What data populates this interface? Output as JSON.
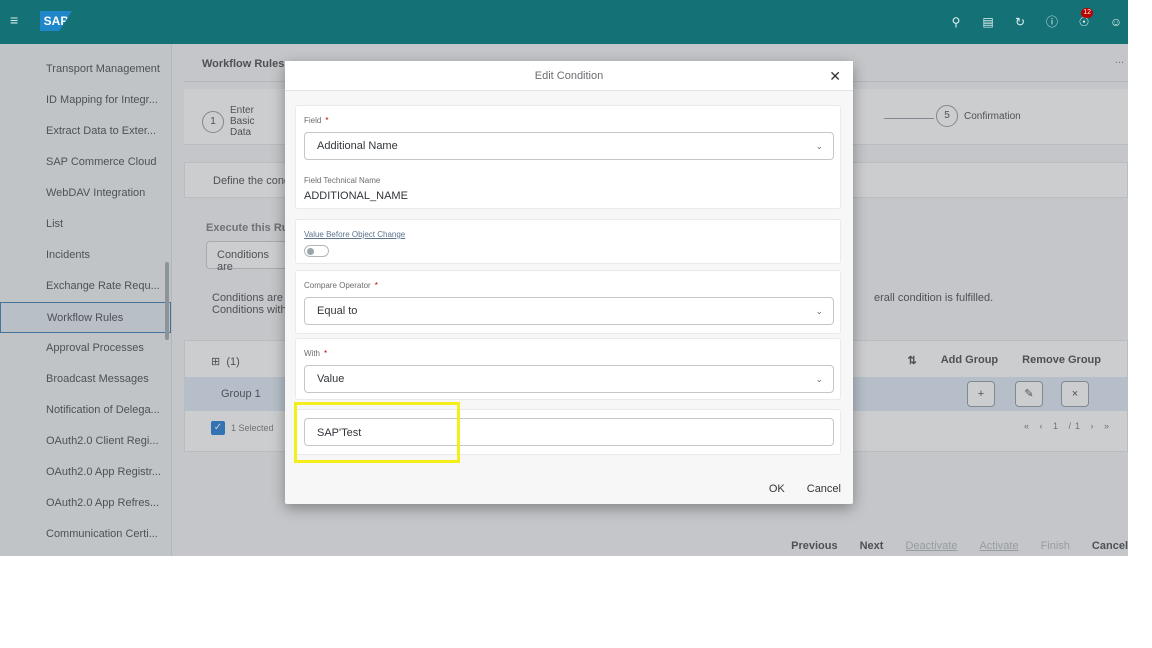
{
  "shell": {
    "logo": "SAP",
    "notifications_count": "12",
    "icons": [
      "search-icon",
      "feedback-icon",
      "history-icon",
      "help-icon",
      "notifications-icon",
      "profile-icon"
    ]
  },
  "sidebar": {
    "items": [
      {
        "label": "Transport Management"
      },
      {
        "label": "ID Mapping for Integr..."
      },
      {
        "label": "Extract Data to Exter..."
      },
      {
        "label": "SAP Commerce Cloud"
      },
      {
        "label": "WebDAV Integration"
      },
      {
        "label": "List"
      },
      {
        "label": "Incidents"
      },
      {
        "label": "Exchange Rate Requ..."
      },
      {
        "label": "Workflow Rules"
      },
      {
        "label": "Approval Processes"
      },
      {
        "label": "Broadcast Messages"
      },
      {
        "label": "Notification of Delega..."
      },
      {
        "label": "OAuth2.0 Client Regi..."
      },
      {
        "label": "OAuth2.0 App Registr..."
      },
      {
        "label": "OAuth2.0 App Refres..."
      },
      {
        "label": "Communication Certi..."
      }
    ],
    "active_index": 8
  },
  "main": {
    "title": "Workflow Rules",
    "more": "...",
    "steps": [
      {
        "num": "1",
        "label": "Enter Basic Data"
      },
      {
        "num": "5",
        "label": "Confirmation"
      }
    ],
    "define_text": "Define the condi",
    "execute_label": "Execute this Rul",
    "execute_value": "Conditions are",
    "conditions_note_1": "Conditions are s",
    "conditions_note_2": "Conditions withi",
    "conditions_note_right": "erall condition is fulfilled.",
    "group_count": "(1)",
    "sort_icon": "sort-icon",
    "add_group": "Add Group",
    "remove_group": "Remove Group",
    "group_name": "Group 1",
    "selected_text": "1 Selected",
    "pager_text": "« ‹ 1 /1 › »",
    "footer": {
      "previous": "Previous",
      "next": "Next",
      "deactivate": "Deactivate",
      "activate": "Activate",
      "finish": "Finish",
      "cancel": "Cancel"
    }
  },
  "dialog": {
    "title": "Edit Condition",
    "field_label": "Field",
    "field_value": "Additional Name",
    "tech_name_label": "Field Technical Name",
    "tech_name_value": "ADDITIONAL_NAME",
    "value_before_label": "Value Before Object Change",
    "toggle_state": "off",
    "operator_label": "Compare Operator",
    "operator_value": "Equal to",
    "with_label": "With",
    "with_value": "Value",
    "value_input": "SAP'Test",
    "ok": "OK",
    "cancel": "Cancel"
  }
}
